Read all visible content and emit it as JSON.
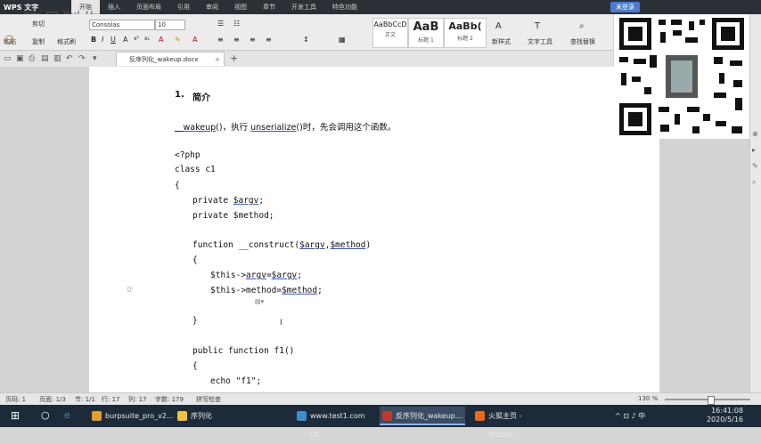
{
  "app": {
    "name": "WPS 文字",
    "watermark": "暗月制作",
    "menu_tabs": [
      "开始",
      "插入",
      "页面布局",
      "引用",
      "审阅",
      "视图",
      "章节",
      "开发工具",
      "特色功能"
    ],
    "active_tab": "开始",
    "login_label": "未登录"
  },
  "ribbon": {
    "paste": "粘贴",
    "cut": "剪切",
    "copy": "复制",
    "format_painter": "格式刷",
    "font_name": "Consolas",
    "font_size": "10",
    "styles": [
      {
        "sample": "AaBbCcD",
        "label": "正文"
      },
      {
        "sample": "AaB",
        "label": "标题 1"
      },
      {
        "sample": "AaBb(",
        "label": "标题 2"
      }
    ],
    "new_style": "新样式",
    "text_tools": "文字工具",
    "find_replace": "查找替换"
  },
  "document_tab": {
    "title": "反序列化_wakeup.docx"
  },
  "document": {
    "heading_number": "1.",
    "heading_text": "简介",
    "intro_pre": "__wakeup",
    "intro_mid": "()，执行 ",
    "intro_func": "unserialize",
    "intro_post": "()时，先会调用这个函数。",
    "code": {
      "l1": "<?php",
      "l2": "class c1",
      "l3": "{",
      "l4a": "private ",
      "l4b": "$argv",
      "l4c": ";",
      "l5": "private $method;",
      "l6a": "function __construct(",
      "l6b": "$argv",
      "l6c": ",",
      "l6d": "$method",
      "l6e": ")",
      "l7": "{",
      "l8a": "$this->",
      "l8b": "argv",
      "l8c": "=",
      "l8d": "$argv",
      "l8e": ";",
      "l9a": "$this->method=",
      "l9b": "$method",
      "l9c": ";",
      "l10": "}",
      "l11": "public function f1()",
      "l12": "{",
      "l13": "echo \"f1\";"
    }
  },
  "statusbar": {
    "page": "页码: 1",
    "pages": "页面: 1/3",
    "section": "节: 1/1",
    "row": "行: 17",
    "col": "列: 17",
    "wordcount": "字数: 179",
    "spellcheck": "拼写检查",
    "zoom": "130 %"
  },
  "taskbar": {
    "items": [
      {
        "label": "burpsuite_pro_v2...",
        "color": "#e0a030"
      },
      {
        "label": "序列化",
        "color": "#f0c040"
      },
      {
        "label": "www.test1.com [D...",
        "color": "#3a8fd0"
      },
      {
        "label": "反序列化_wakeup...",
        "color": "#c0392b"
      },
      {
        "label": "火狐主页 - Mozilla...",
        "color": "#e86a1a"
      }
    ],
    "time": "16:41:08",
    "date": "2020/5/16"
  }
}
